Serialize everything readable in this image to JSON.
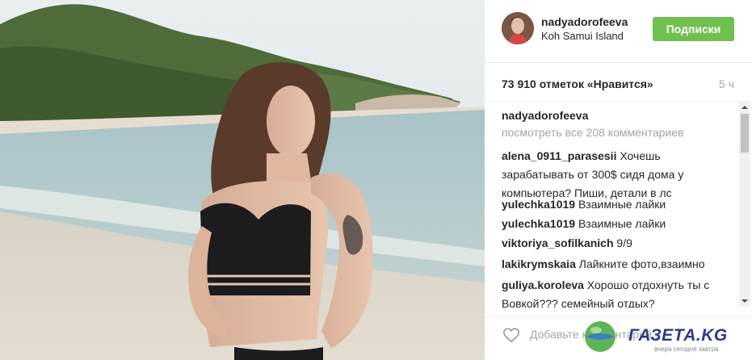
{
  "post": {
    "photo_icon": "beach-photo"
  },
  "header": {
    "username": "nadyadorofeeva",
    "location": "Koh Samui Island",
    "follow_label": "Подписки",
    "follow_color": "#70c050"
  },
  "stats": {
    "likes": "73 910 отметок «Нравится»",
    "time_ago": "5 ч"
  },
  "comments": {
    "caption_user": "nadyadorofeeva",
    "caption_text": "",
    "view_all": "посмотреть все 208 комментариев",
    "items": [
      {
        "user": "alena_0911_parasesii",
        "text": "Хочешь зарабатывать от 300$ сидя дома у компьютера? Пиши, детали в лс"
      },
      {
        "user": "yulechka1019",
        "text": "Взаимные лайки"
      },
      {
        "user": "yulechka1019",
        "text": "Взаимные лайки"
      },
      {
        "user": "viktoriya_sofilkanich",
        "text": "9/9"
      },
      {
        "user": "lakikrymskaia",
        "text": "Лайкните фото,взаимно"
      },
      {
        "user": "guliya.koroleva",
        "text": "Хорошо отдохнуть ты с Вовкой??? семейный отдых?"
      }
    ]
  },
  "footer": {
    "add_comment_placeholder": "Добавьте комментарий..."
  },
  "watermark": {
    "brand": "ГАЗЕТА.KG",
    "tagline": "вчера сегодня завтра"
  }
}
